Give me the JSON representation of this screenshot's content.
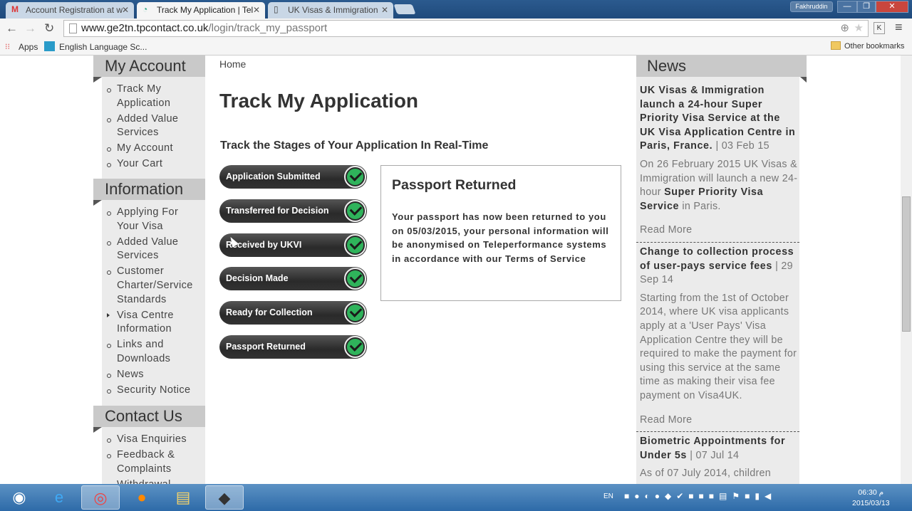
{
  "browser": {
    "tabs": [
      {
        "label": "Account Registration at w",
        "icon": "gmail-icon"
      },
      {
        "label": "Track My Application | Tel",
        "icon": "site-favicon"
      },
      {
        "label": "UK Visas & Immigration",
        "icon": "page-icon"
      }
    ],
    "user": "Fakhruddin",
    "url_domain": "www.ge2tn.tpcontact.co.uk",
    "url_path": "/login/track_my_passport",
    "bookmarks": {
      "apps": "Apps",
      "item1": "English Language Sc...",
      "other": "Other bookmarks"
    }
  },
  "page": {
    "breadcrumb": "Home",
    "title": "Track My Application",
    "subtitle": "Track the Stages of Your Application In Real-Time",
    "stages": [
      {
        "label": "Application Submitted",
        "complete": true
      },
      {
        "label": "Transferred for Decision",
        "complete": true
      },
      {
        "label": "Received by UKVI",
        "complete": true
      },
      {
        "label": "Decision Made",
        "complete": true
      },
      {
        "label": "Ready for Collection",
        "complete": true
      },
      {
        "label": "Passport Returned",
        "complete": true
      }
    ],
    "status_box": {
      "title": "Passport Returned",
      "text": "Your passport has now been returned to you on 05/03/2015, your personal information will be anonymised on Teleperformance systems in accordance with our Terms of Service"
    }
  },
  "sidebar": {
    "sections": [
      {
        "heading": "My Account",
        "items": [
          "Track My Application",
          "Added Value Services",
          "My Account",
          "Your Cart"
        ]
      },
      {
        "heading": "Information",
        "items": [
          "Applying For Your Visa",
          "Added Value Services",
          "Customer Charter/Service Standards",
          "Visa Centre Information",
          "Links and Downloads",
          "News",
          "Security Notice"
        ]
      },
      {
        "heading": "Contact Us",
        "items": [
          "Visa Enquiries",
          "Feedback & Complaints",
          "Withdrawal"
        ]
      }
    ]
  },
  "news": {
    "heading": "News",
    "items": [
      {
        "title": "UK Visas & Immigration launch a 24-hour Super Priority Visa Service at the UK Visa Application Centre in Paris, France.",
        "date": " | 03 Feb 15",
        "body_pre": "On 26 February 2015 UK Visas & Immigration will launch a new 24-hour ",
        "body_bold": "Super Priority Visa Service",
        "body_post": " in Paris.",
        "read_more": "Read More"
      },
      {
        "title": "Change to collection process of user-pays service fees",
        "date": " | 29 Sep 14",
        "body_pre": "Starting from the 1st of October 2014, where UK visa applicants apply at a 'User Pays' Visa Application Centre they will be required to make the payment for using this service at the same time as making their visa fee payment on Visa4UK.",
        "read_more": "Read More"
      },
      {
        "title": "Biometric Appointments for Under 5s",
        "date": " | 07 Jul 14",
        "body_pre": "As of 07 July 2014, children"
      }
    ]
  },
  "taskbar": {
    "lang": "EN",
    "time": "06:30 م",
    "date": "2015/03/13"
  },
  "colors": {
    "check_green": "#2fb35b",
    "sidebar_bg": "#ebebeb",
    "heading_bg": "#c9c9c9"
  }
}
